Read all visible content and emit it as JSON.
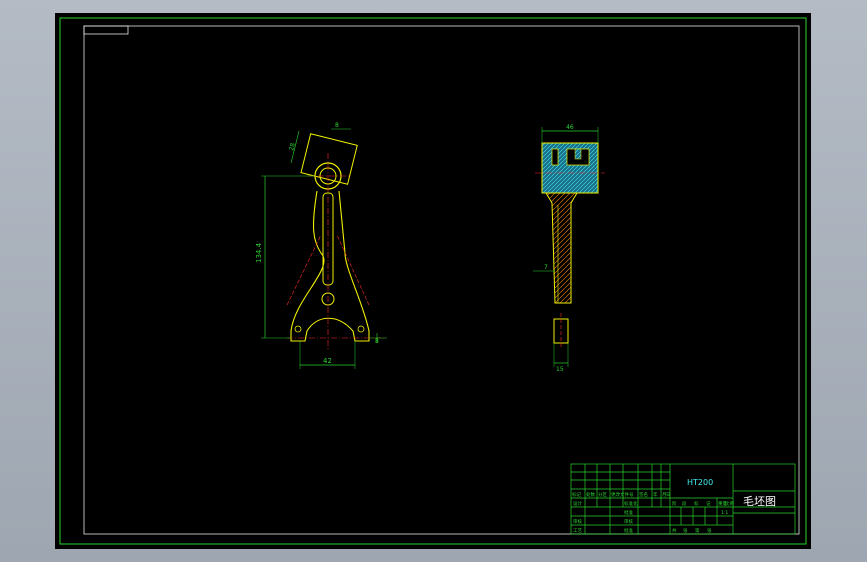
{
  "title_block": {
    "material": "HT200",
    "drawing_name": "毛坯图",
    "header_row": [
      "标记",
      "处数",
      "分区",
      "更改文件号",
      "签名",
      "年",
      "月",
      "日"
    ],
    "left_labels": [
      "设计",
      "审核",
      "工艺"
    ],
    "mid_labels": [
      "标准化",
      "批准",
      "审核",
      "批准"
    ],
    "stage_labels": [
      "阶",
      "段",
      "标",
      "记",
      "重量",
      "比例"
    ],
    "sheet_labels": [
      "共",
      "张",
      "第",
      "张"
    ],
    "scale_value": "1:1"
  },
  "dimensions": {
    "front_top_width": "8",
    "front_head_size": "28",
    "front_height": "134.4",
    "front_bottom_width": "42",
    "front_bottom_small": "8",
    "side_top_width": "46",
    "side_mid": "7",
    "side_bottom_width": "15"
  },
  "colors": {
    "frame": "#29d32f",
    "outline": "#f0f000",
    "hatch": "#3ff0f0",
    "centerline": "#ff2a2a",
    "text": "#29d32f"
  }
}
